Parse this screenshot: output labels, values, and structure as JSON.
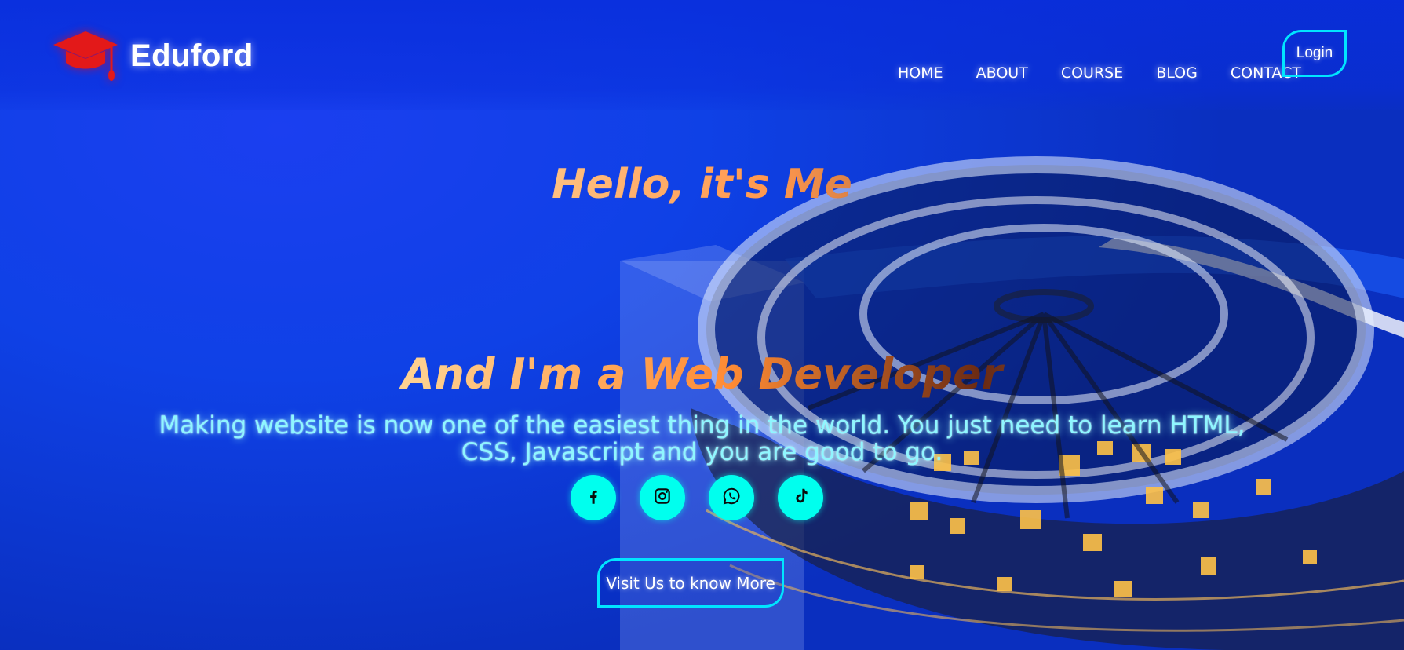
{
  "brand": {
    "name": "Eduford"
  },
  "nav": {
    "items": [
      {
        "label": "HOME"
      },
      {
        "label": "ABOUT"
      },
      {
        "label": "COURSE"
      },
      {
        "label": "BLOG"
      },
      {
        "label": "CONTACT"
      }
    ],
    "login_label": "Login"
  },
  "hero": {
    "title": "Hello, it's Me",
    "subtitle": "And I'm a Web Developer",
    "description": "Making website is now one of the easiest thing in the world. You just need to learn HTML, CSS, Javascript and you are good to go.",
    "cta_label": "Visit Us to know More"
  },
  "social": {
    "icons": [
      "facebook-icon",
      "instagram-icon",
      "whatsapp-icon",
      "tiktok-icon"
    ]
  },
  "colors": {
    "background": "#0f41e6",
    "accent_cyan": "#00ffee",
    "border_cyan": "#00e5ff",
    "logo_red": "#e31919"
  }
}
